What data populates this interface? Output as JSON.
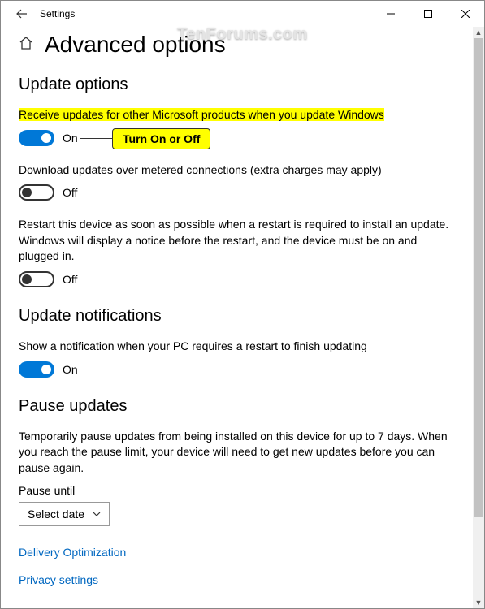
{
  "window": {
    "app_title": "Settings"
  },
  "watermark": "TenForums.com",
  "page": {
    "title": "Advanced options"
  },
  "sections": {
    "update_options": {
      "title": "Update options",
      "items": [
        {
          "label": "Receive updates for other Microsoft products when you update Windows",
          "state": "On",
          "on": true,
          "highlighted": true
        },
        {
          "label": "Download updates over metered connections (extra charges may apply)",
          "state": "Off",
          "on": false
        },
        {
          "label": "Restart this device as soon as possible when a restart is required to install an update. Windows will display a notice before the restart, and the device must be on and plugged in.",
          "state": "Off",
          "on": false
        }
      ]
    },
    "update_notifications": {
      "title": "Update notifications",
      "items": [
        {
          "label": "Show a notification when your PC requires a restart to finish updating",
          "state": "On",
          "on": true
        }
      ]
    },
    "pause_updates": {
      "title": "Pause updates",
      "description": "Temporarily pause updates from being installed on this device for up to 7 days. When you reach the pause limit, your device will need to get new updates before you can pause again.",
      "pause_until_label": "Pause until",
      "dropdown_value": "Select date"
    }
  },
  "links": {
    "delivery": "Delivery Optimization",
    "privacy": "Privacy settings"
  },
  "callout": "Turn On or Off"
}
